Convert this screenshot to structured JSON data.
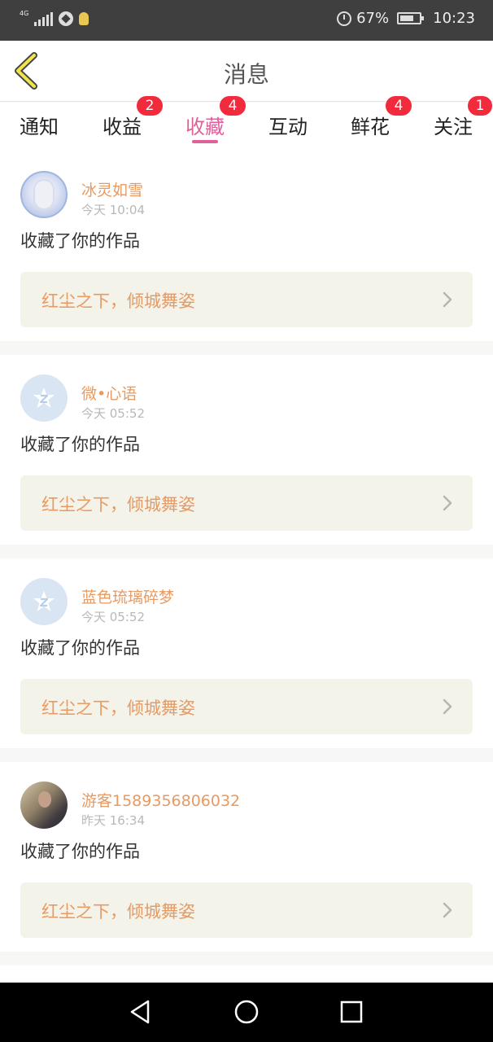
{
  "status_bar": {
    "network": "4G",
    "battery": "67%",
    "time": "10:23",
    "icons": [
      "signal-icon",
      "app-icon",
      "bulb-icon",
      "alarm-icon",
      "battery-icon"
    ]
  },
  "header": {
    "title": "消息",
    "back_icon": "back-chevron-icon",
    "accent_color": "#e0609a"
  },
  "tabs": [
    {
      "label": "通知",
      "badge": ""
    },
    {
      "label": "收益",
      "badge": "2"
    },
    {
      "label": "收藏",
      "badge": "4",
      "active": true
    },
    {
      "label": "互动",
      "badge": ""
    },
    {
      "label": "鲜花",
      "badge": "4"
    },
    {
      "label": "关注",
      "badge": "1"
    }
  ],
  "feed": [
    {
      "name": "冰灵如雪",
      "time": "今天 10:04",
      "action": "收藏了你的作品",
      "work": "红尘之下，倾城舞姿",
      "avatar": "anime-avatar"
    },
    {
      "name": "微•心语",
      "time": "今天 05:52",
      "action": "收藏了你的作品",
      "work": "红尘之下，倾城舞姿",
      "avatar": "default-avatar"
    },
    {
      "name": "蓝色琉璃碎梦",
      "time": "今天 05:52",
      "action": "收藏了你的作品",
      "work": "红尘之下，倾城舞姿",
      "avatar": "default-avatar"
    },
    {
      "name": "游客1589356806032",
      "time": "昨天 16:34",
      "action": "收藏了你的作品",
      "work": "红尘之下，倾城舞姿",
      "avatar": "photo-avatar"
    }
  ],
  "colors": {
    "name_color": "#e79a62",
    "badge_color": "#f22b3c",
    "card_bg": "#f4f3ea"
  },
  "nav_bar": [
    "back-nav-icon",
    "home-nav-icon",
    "recent-apps-icon"
  ]
}
